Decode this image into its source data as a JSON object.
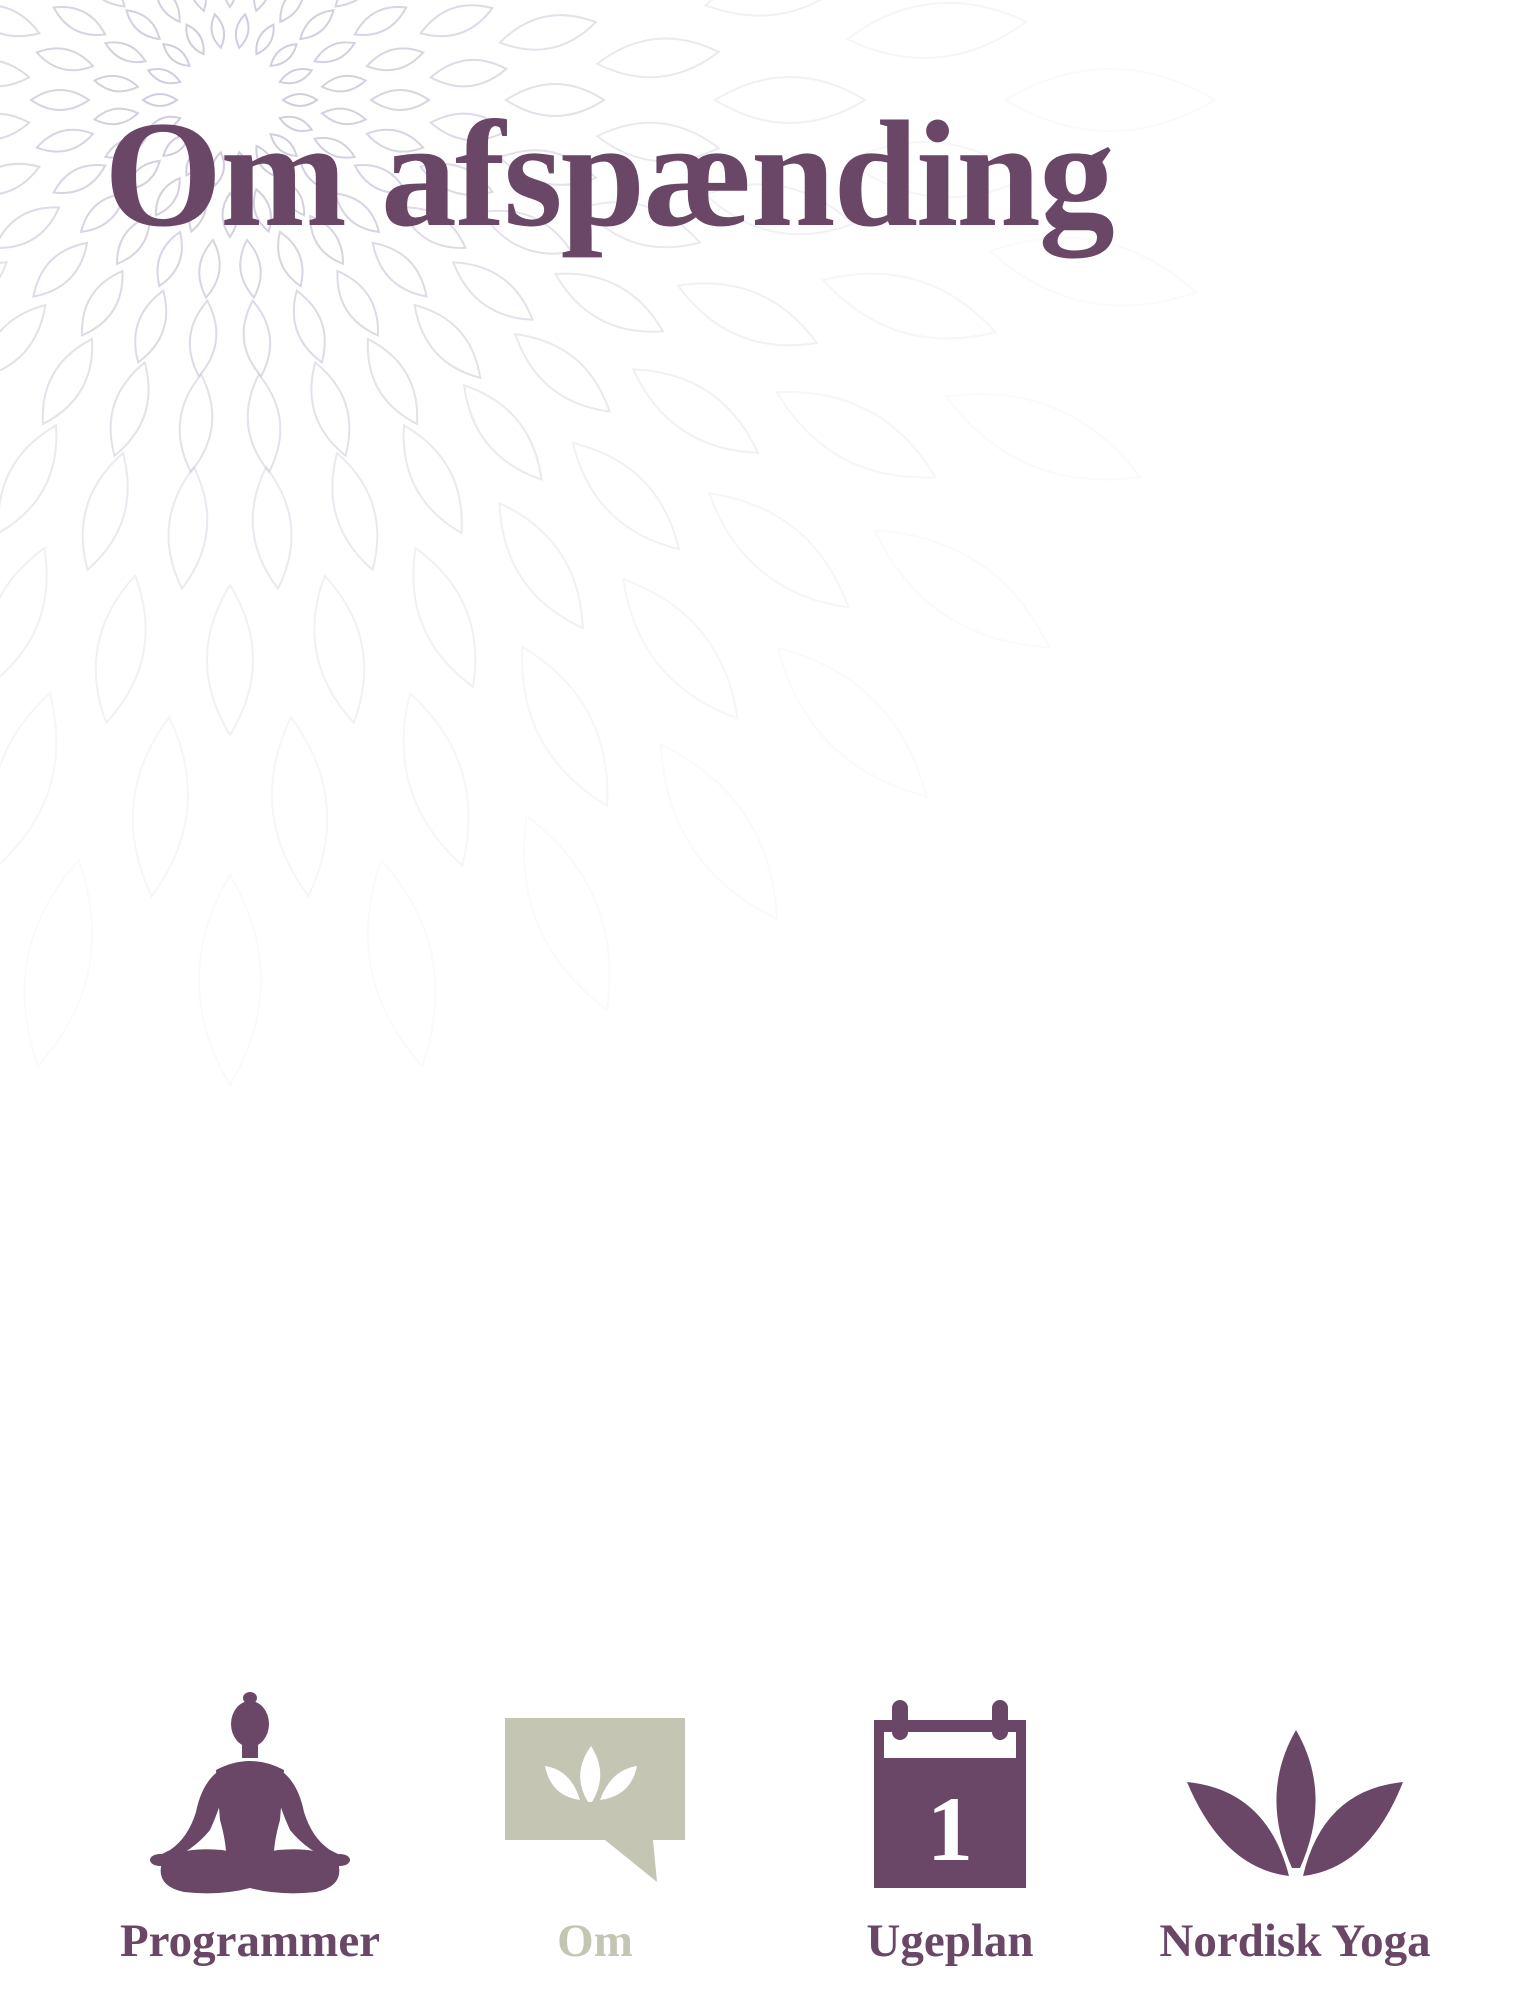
{
  "page": {
    "title": "Om afspænding"
  },
  "tab_bar": {
    "tabs": [
      {
        "label": "Programmer",
        "icon": "meditation-pose-icon",
        "active": false
      },
      {
        "label": "Om",
        "icon": "lotus-speech-bubble-icon",
        "active": true
      },
      {
        "label": "Ugeplan",
        "icon": "calendar-icon",
        "active": false
      },
      {
        "label": "Nordisk Yoga",
        "icon": "lotus-icon",
        "active": false
      }
    ],
    "calendar_day": "1"
  },
  "colors": {
    "brand_purple": "#6a4667",
    "active_tab": "#c5c5b3",
    "pattern_stroke": "#c9c4d8"
  }
}
